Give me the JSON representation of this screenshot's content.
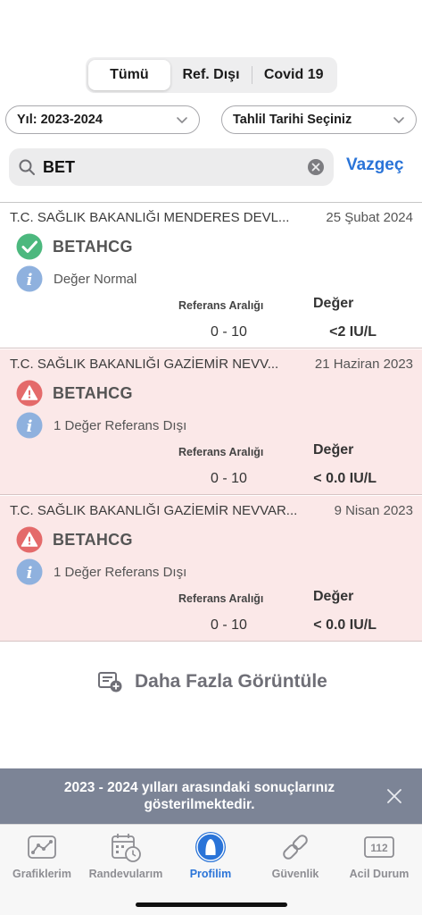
{
  "segments": [
    {
      "label": "Tümü",
      "active": true
    },
    {
      "label": "Ref. Dışı",
      "active": false
    },
    {
      "label": "Covid 19",
      "active": false
    }
  ],
  "filters": {
    "year": "Yıl: 2023-2024",
    "date": "Tahlil Tarihi Seçiniz"
  },
  "search": {
    "value": "BET",
    "cancel_label": "Vazgeç"
  },
  "results": [
    {
      "institution": "T.C. SAĞLIK BAKANLIĞI MENDERES DEVL...",
      "date": "25 Şubat 2024",
      "test": "BETAHCG",
      "status": "normal",
      "status_icon": "check-circle-icon",
      "info": "Değer Normal",
      "range_label": "Referans Aralığı",
      "value_label": "Değer",
      "range": "0 - 10",
      "value": "<2 IU/L"
    },
    {
      "institution": "T.C. SAĞLIK BAKANLIĞI GAZİEMİR NEVV...",
      "date": "21 Haziran 2023",
      "test": "BETAHCG",
      "status": "abnormal",
      "status_icon": "warning-icon",
      "info": "1 Değer Referans Dışı",
      "range_label": "Referans Aralığı",
      "value_label": "Değer",
      "range": "0 - 10",
      "value": "< 0.0 IU/L"
    },
    {
      "institution": "T.C. SAĞLIK BAKANLIĞI GAZİEMİR NEVVAR...",
      "date": "9 Nisan 2023",
      "test": "BETAHCG",
      "status": "abnormal",
      "status_icon": "warning-icon",
      "info": "1 Değer Referans Dışı",
      "range_label": "Referans Aralığı",
      "value_label": "Değer",
      "range": "0 - 10",
      "value": "< 0.0 IU/L"
    }
  ],
  "more_label": "Daha Fazla Görüntüle",
  "banner": {
    "text": "2023 - 2024 yılları arasındaki sonuçlarınız gösterilmektedir."
  },
  "tabs": [
    {
      "label": "Grafiklerim",
      "icon": "chart-icon",
      "selected": false
    },
    {
      "label": "Randevularım",
      "icon": "calendar-clock-icon",
      "selected": false
    },
    {
      "label": "Profilim",
      "icon": "profile-icon",
      "selected": true
    },
    {
      "label": "Güvenlik",
      "icon": "link-icon",
      "selected": false
    },
    {
      "label": "Acil Durum",
      "icon": "emergency-112-icon",
      "selected": false,
      "badge_text": "112"
    }
  ],
  "colors": {
    "accent": "#2a74d8",
    "normal_green": "#4cb87e",
    "warning_red": "#e46a6a",
    "abnormal_bg": "#fbe8e8",
    "banner_bg": "#7c8496"
  }
}
